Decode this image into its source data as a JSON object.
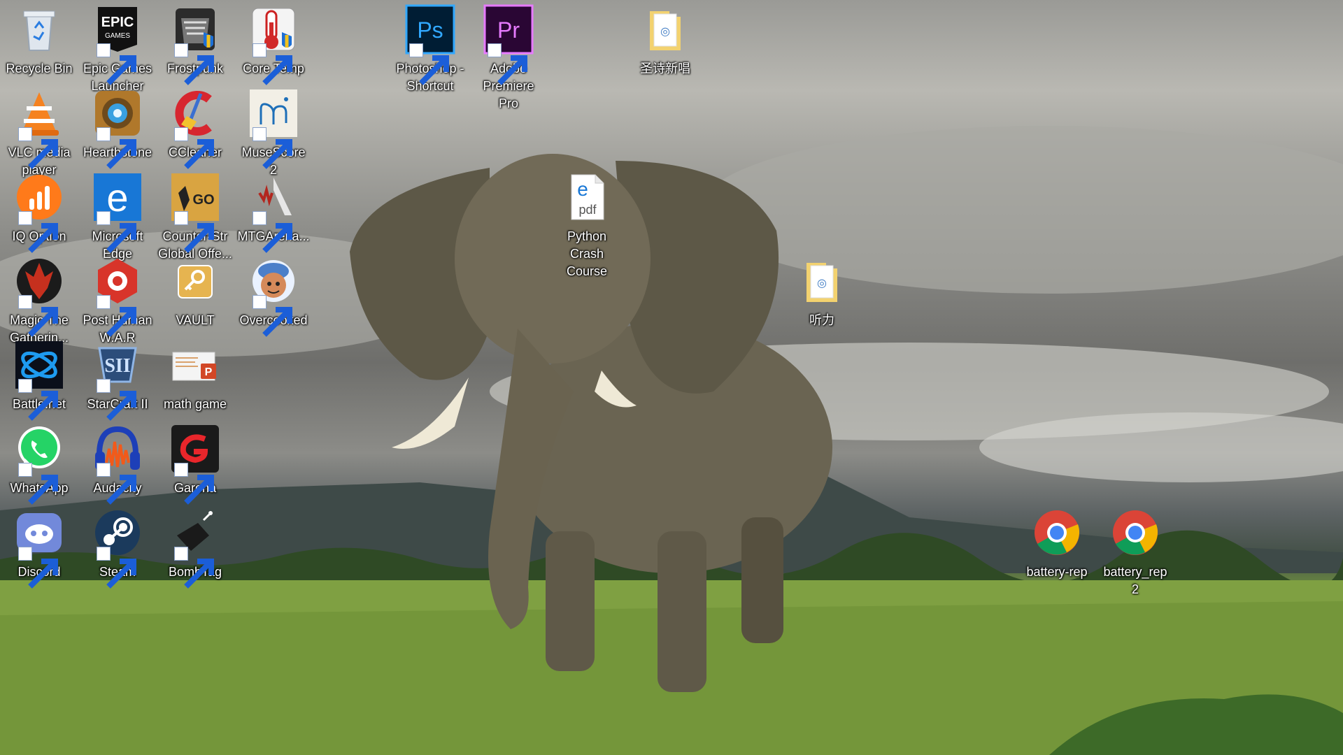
{
  "desktop": {
    "icons": [
      {
        "label": "Recycle Bin",
        "icon": "recycle-bin-icon"
      },
      {
        "label": "Epic Games Launcher",
        "icon": "epic-games-icon"
      },
      {
        "label": "Frostpunk",
        "icon": "frostpunk-icon"
      },
      {
        "label": "Core Temp",
        "icon": "core-temp-icon"
      },
      {
        "label": "Photoshop - Shortcut",
        "icon": "photoshop-icon",
        "glyph": "Ps"
      },
      {
        "label": "Adobe Premiere Pro",
        "icon": "premiere-icon",
        "glyph": "Pr"
      },
      {
        "label": "圣诗新唱",
        "icon": "folder-icon"
      },
      {
        "label": "VLC media player",
        "icon": "vlc-icon"
      },
      {
        "label": "Hearthstone",
        "icon": "hearthstone-icon"
      },
      {
        "label": "CCleaner",
        "icon": "ccleaner-icon"
      },
      {
        "label": "MuseScore 2",
        "icon": "musescore-icon"
      },
      {
        "label": "IQ Option",
        "icon": "iq-option-icon"
      },
      {
        "label": "Microsoft Edge",
        "icon": "edge-icon"
      },
      {
        "label": "Counter-Str Global Offe...",
        "icon": "csgo-icon",
        "glyph": "GO"
      },
      {
        "label": "MTGArena...",
        "icon": "mtg-arena-icon"
      },
      {
        "label": "Python Crash Course",
        "icon": "pdf-file-icon",
        "glyph": "pdf"
      },
      {
        "label": "Magic The Gatherin...",
        "icon": "magic-gathering-icon"
      },
      {
        "label": "Post Human W.A.R",
        "icon": "post-human-icon"
      },
      {
        "label": "VAULT",
        "icon": "vault-icon"
      },
      {
        "label": "Overcooked",
        "icon": "overcooked-icon"
      },
      {
        "label": "听力",
        "icon": "folder-icon"
      },
      {
        "label": "Battle.net",
        "icon": "battlenet-icon"
      },
      {
        "label": "StarCraft II",
        "icon": "starcraft-icon"
      },
      {
        "label": "math game",
        "icon": "powerpoint-file-icon"
      },
      {
        "label": "WhatsApp",
        "icon": "whatsapp-icon"
      },
      {
        "label": "Audacity",
        "icon": "audacity-icon"
      },
      {
        "label": "Garena",
        "icon": "garena-icon"
      },
      {
        "label": "Discord",
        "icon": "discord-icon"
      },
      {
        "label": "Steam",
        "icon": "steam-icon"
      },
      {
        "label": "BombTag",
        "icon": "bombtag-icon"
      },
      {
        "label": "battery-rep",
        "icon": "chrome-html-icon"
      },
      {
        "label": "battery_rep 2",
        "icon": "chrome-html-icon"
      }
    ]
  },
  "wallpaper": "elephant-savanna"
}
